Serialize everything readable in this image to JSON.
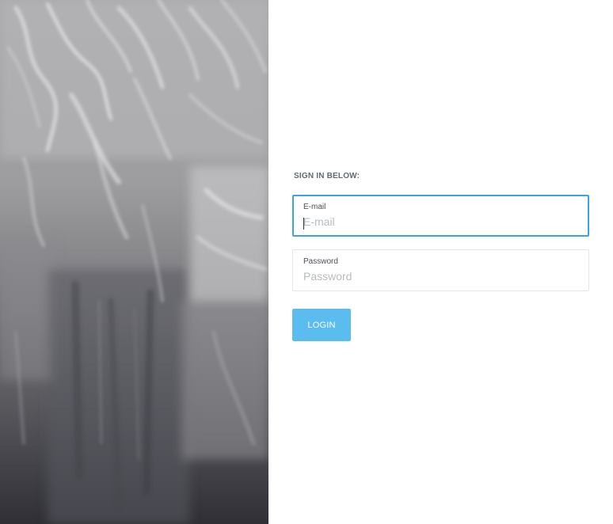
{
  "login": {
    "heading": "SIGN IN BELOW:",
    "email": {
      "label": "E-mail",
      "placeholder": "E-mail",
      "value": ""
    },
    "password": {
      "label": "Password",
      "placeholder": "Password",
      "value": ""
    },
    "submit_label": "LOGIN"
  },
  "colors": {
    "accent": "#3aa5e6",
    "button": "#5bbcf0"
  }
}
